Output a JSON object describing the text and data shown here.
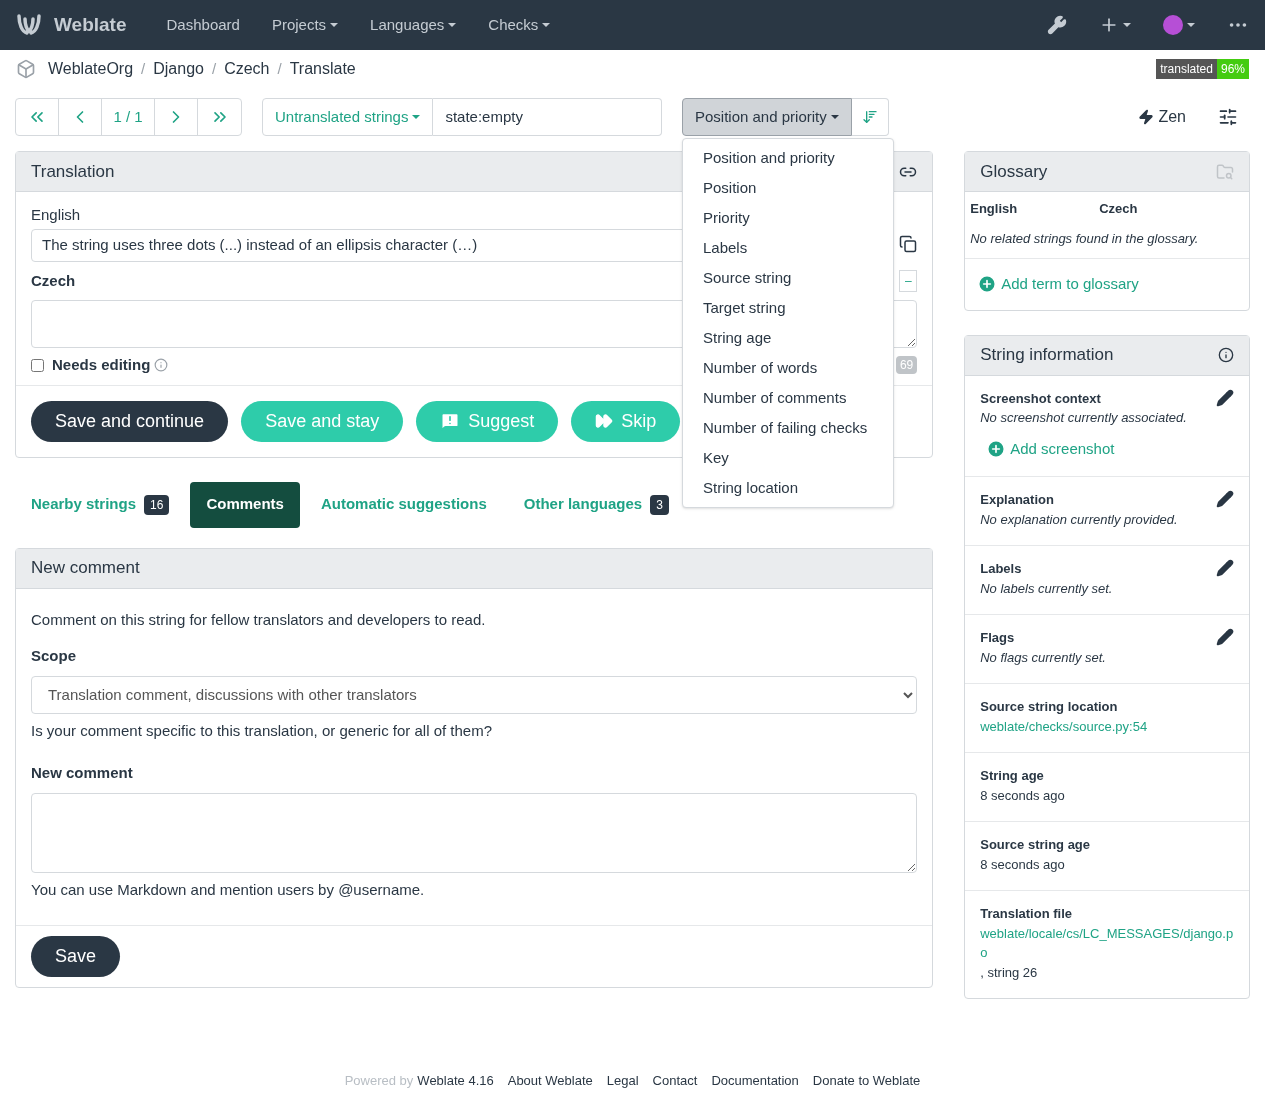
{
  "navbar": {
    "brand": "Weblate",
    "menu": [
      {
        "label": "Dashboard",
        "caret": false
      },
      {
        "label": "Projects",
        "caret": true
      },
      {
        "label": "Languages",
        "caret": true
      },
      {
        "label": "Checks",
        "caret": true
      }
    ]
  },
  "breadcrumbs": [
    "WeblateOrg",
    "Django",
    "Czech",
    "Translate"
  ],
  "breadcrumb_separator": "/",
  "badge": {
    "label": "translated",
    "value": "96%"
  },
  "pager": {
    "position": "1 / 1"
  },
  "filter": {
    "label": "Untranslated strings",
    "query": "state:empty"
  },
  "sort": {
    "label": "Position and priority",
    "menu": [
      {
        "label": "Position and priority"
      },
      {
        "label": "Position"
      },
      {
        "label": "Priority"
      },
      {
        "label": "Labels"
      },
      {
        "label": "Source string"
      },
      {
        "label": "Target string"
      },
      {
        "label": "String age"
      },
      {
        "label": "Number of words"
      },
      {
        "label": "Number of comments"
      },
      {
        "label": "Number of failing checks"
      },
      {
        "label": "Key"
      },
      {
        "label": "String location"
      }
    ]
  },
  "zen": "Zen",
  "translation": {
    "title": "Translation",
    "source_label": "English",
    "source_text": "The string uses three dots (...) instead of an ellipsis character (…)",
    "target_label": "Czech",
    "size_button": "–",
    "needs_editing": {
      "label": "Needs editing",
      "checked": false
    },
    "counter": "69",
    "buttons": [
      {
        "label": "Save and continue",
        "kind": "primary"
      },
      {
        "label": "Save and stay",
        "kind": "secondary"
      },
      {
        "label": "Suggest",
        "kind": "suggest"
      },
      {
        "label": "Skip",
        "kind": "skip"
      }
    ]
  },
  "tabs": [
    {
      "label": "Nearby strings",
      "count": "16",
      "selected": false
    },
    {
      "label": "Comments",
      "selected": true
    },
    {
      "label": "Automatic suggestions",
      "selected": false
    },
    {
      "label": "Other languages",
      "count": "3",
      "selected": false
    }
  ],
  "comment": {
    "title": "New comment",
    "intro": "Comment on this string for fellow translators and developers to read.",
    "scope_label": "Scope",
    "scope_value": "Translation comment, discussions with other translators",
    "scope_help": "Is your comment specific to this translation, or generic for all of them?",
    "new_label": "New comment",
    "markdown_help": "You can use Markdown and mention users by @username.",
    "save": "Save"
  },
  "glossary": {
    "title": "Glossary",
    "columns": [
      "English",
      "Czech"
    ],
    "empty": "No related strings found in the glossary.",
    "add": "Add term to glossary"
  },
  "info": {
    "title": "String information",
    "items": [
      {
        "kind": "note",
        "title": "Screenshot context",
        "text": "No screenshot currently associated.",
        "editable": true,
        "action": "Add screenshot"
      },
      {
        "kind": "note",
        "title": "Explanation",
        "text": "No explanation currently provided.",
        "editable": true
      },
      {
        "kind": "note",
        "title": "Labels",
        "text": "No labels currently set.",
        "editable": true
      },
      {
        "kind": "note",
        "title": "Flags",
        "text": "No flags currently set.",
        "editable": true
      },
      {
        "kind": "link",
        "title": "Source string location",
        "text": "weblate/checks/source.py:54",
        "editable": false
      },
      {
        "kind": "plain",
        "title": "String age",
        "text": "8 seconds ago",
        "editable": false
      },
      {
        "kind": "plain",
        "title": "Source string age",
        "text": "8 seconds ago",
        "editable": false
      },
      {
        "kind": "file",
        "title": "Translation file",
        "text": "weblate/locale/cs/LC_MESSAGES/django.po",
        "suffix": ", string 26",
        "editable": false
      }
    ]
  },
  "footer": {
    "powered": "Powered by",
    "links": [
      "Weblate 4.16",
      "About Weblate",
      "Legal",
      "Contact",
      "Documentation",
      "Donate to Weblate"
    ]
  }
}
